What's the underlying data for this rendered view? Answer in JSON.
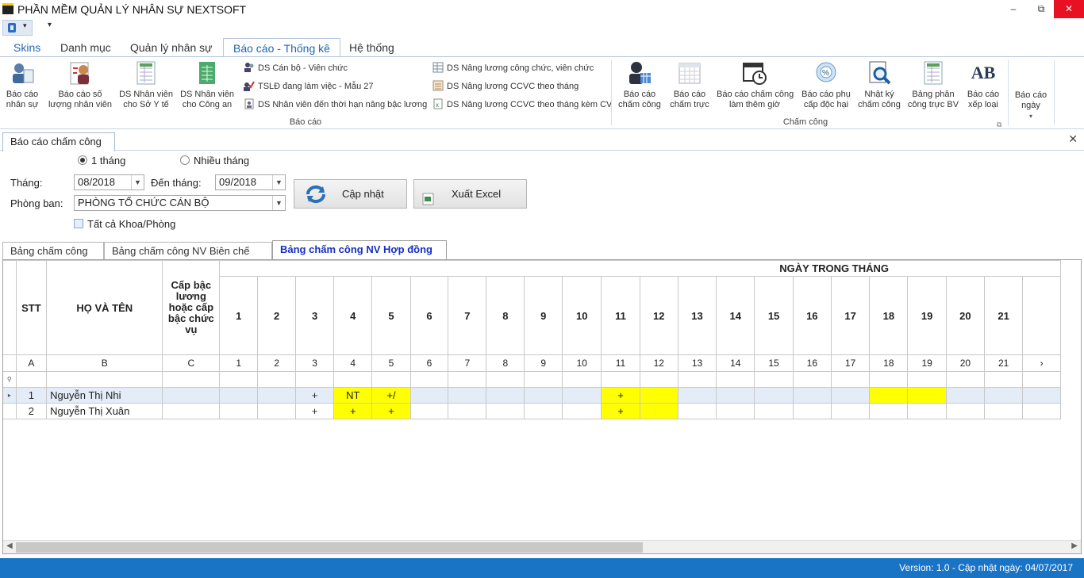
{
  "window": {
    "title": "PHẦN MỀM QUẢN LÝ NHÂN SỰ NEXTSOFT",
    "min": "–",
    "max": "⧉",
    "close": "✕"
  },
  "qat": {
    "customize": "▾"
  },
  "menu": {
    "tabs": [
      "Skins",
      "Danh mục",
      "Quản lý nhân sự",
      "Báo cáo - Thống kê",
      "Hệ thống"
    ]
  },
  "ribbon": {
    "baocao_big": [
      "Báo cáo\nnhân sự",
      "Báo cáo số\nlượng nhân viên",
      "DS Nhân viên\ncho Sở Y tế",
      "DS Nhân viên\ncho Công an"
    ],
    "baocao_small": [
      "DS Cán bộ - Viên chức",
      "TSLĐ đang làm việc - Mẫu 27",
      "DS Nhân viên đến thời hạn nâng bậc lương",
      "DS Nâng lương công chức, viên chức",
      "DS Nâng lương CCVC theo tháng",
      "DS Nâng lương CCVC theo tháng kèm CV"
    ],
    "group_baocao": "Báo cáo",
    "chamcong_big": [
      "Báo cáo\nchấm công",
      "Báo cáo\nchấm trực",
      "Báo cáo chấm công\nlàm thêm giờ",
      "Báo cáo phụ\ncấp độc hại",
      "Nhật ký\nchấm công",
      "Bảng phân\ncông trực BV",
      "Báo cáo\nxếp loại"
    ],
    "group_chamcong": "Chấm công",
    "baocao_ngay": "Báo cáo\nngày",
    "ab": "AB"
  },
  "doc_tab": {
    "label": "Báo cáo chấm công",
    "close": "✕"
  },
  "filters": {
    "radio_one": "1 tháng",
    "radio_many": "Nhiều tháng",
    "thang_label": "Tháng:",
    "thang_value": "08/2018",
    "den_thang_label": "Đến tháng:",
    "den_thang_value": "09/2018",
    "phong_ban_label": "Phòng ban:",
    "phong_ban_value": "PHÒNG TỔ CHỨC CÁN BỘ",
    "tat_ca": "Tất cả Khoa/Phòng",
    "update_btn": "Cập nhật",
    "excel_btn": "Xuất Excel"
  },
  "subtabs": [
    "Bảng chấm công",
    "Bảng chấm công NV Biên chế",
    "Bảng chấm công NV Hợp đồng"
  ],
  "grid": {
    "ngay_header": "NGÀY TRONG THÁNG",
    "headers": {
      "stt": "STT",
      "name": "HỌ VÀ TÊN",
      "cap": "Cấp bậc lương hoặc cấp bậc chức vụ"
    },
    "letters": [
      "A",
      "B",
      "C"
    ],
    "days": [
      "1",
      "2",
      "3",
      "4",
      "5",
      "6",
      "7",
      "8",
      "9",
      "10",
      "11",
      "12",
      "13",
      "14",
      "15",
      "16",
      "17",
      "18",
      "19",
      "20",
      "21"
    ],
    "rows": [
      {
        "stt": "1",
        "name": "Nguyễn Thị Nhi",
        "cells": {
          "3": "+",
          "4": "NT",
          "5": "+/",
          "11": "+"
        }
      },
      {
        "stt": "2",
        "name": "Nguyễn Thị Xuân",
        "cells": {
          "3": "+",
          "4": "+",
          "5": "+",
          "11": "+"
        }
      }
    ]
  },
  "status": "Version: 1.0 - Cập nhật ngày: 04/07/2017"
}
